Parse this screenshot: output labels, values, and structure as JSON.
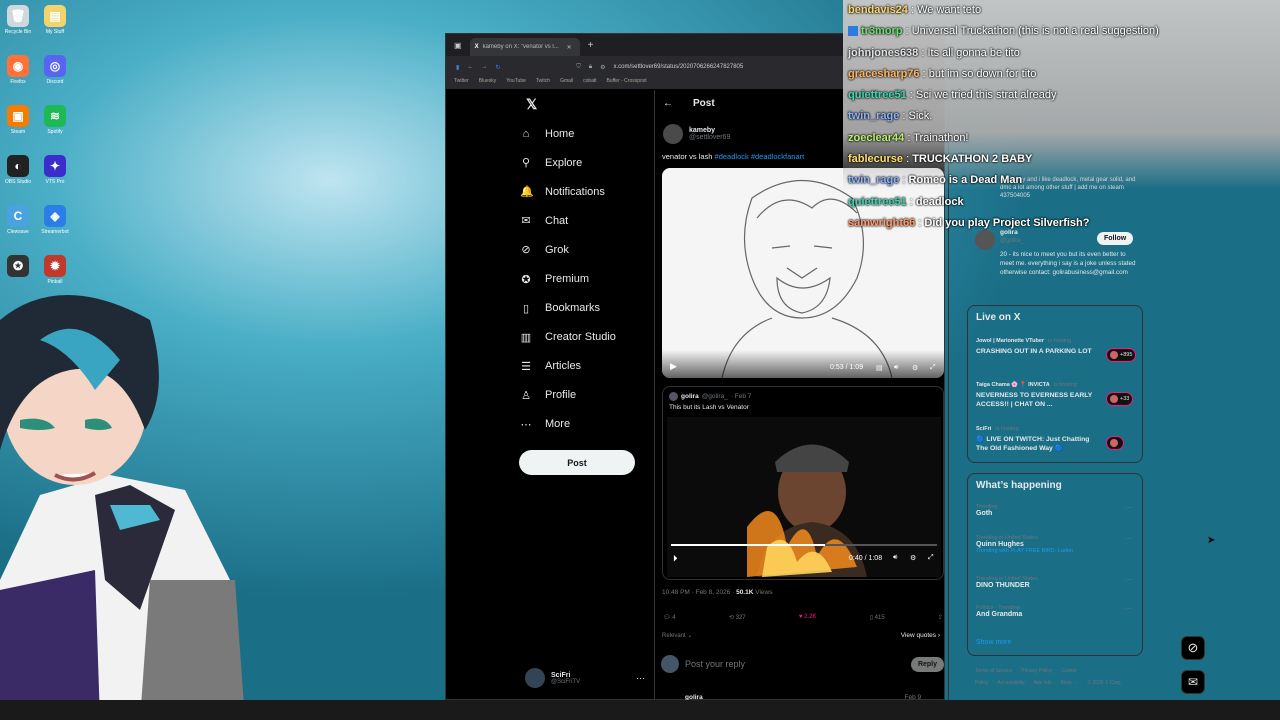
{
  "desktop_icons": [
    {
      "label": "Recycle Bin",
      "icon": "recycle-bin-icon",
      "color": "#cfd8dc",
      "glyph": "🗑"
    },
    {
      "label": "My Stuff",
      "icon": "folder-icon",
      "color": "#f3d36b",
      "glyph": "▤"
    },
    {
      "label": "Firefox",
      "icon": "firefox-icon",
      "color": "#ff7139",
      "glyph": "◉"
    },
    {
      "label": "Discord",
      "icon": "discord-icon",
      "color": "#5865f2",
      "glyph": "◎"
    },
    {
      "label": "Steam",
      "icon": "steam-icon",
      "color": "#f57c00",
      "glyph": "▣"
    },
    {
      "label": "Spotify",
      "icon": "spotify-icon",
      "color": "#1db954",
      "glyph": "≋"
    },
    {
      "label": "OBS Studio",
      "icon": "obs-icon",
      "color": "#222",
      "glyph": "◐"
    },
    {
      "label": "VTS Pro",
      "icon": "vts-icon",
      "color": "#3b2ccc",
      "glyph": "✦"
    },
    {
      "label": "Clewsave",
      "icon": "clewsave-icon",
      "color": "#4aa3df",
      "glyph": "C"
    },
    {
      "label": "Streamerbot",
      "icon": "streamerbot-icon",
      "color": "#2b7de9",
      "glyph": "◈"
    },
    {
      "label": "",
      "icon": "app-icon",
      "color": "#333",
      "glyph": "✪"
    },
    {
      "label": "Pinball",
      "icon": "pinball-icon",
      "color": "#c0392b",
      "glyph": "✹"
    }
  ],
  "browser": {
    "tab_title": "kameby on X: \"venator vs l...",
    "url": "x.com/settlover69/status/2020706266247827805",
    "bookmarks": [
      "Twitter",
      "Bluesky",
      "YouTube",
      "Twitch",
      "Gmail",
      "cobalt",
      "Buffer - Crosspost"
    ]
  },
  "nav": {
    "items": [
      {
        "label": "Home",
        "icon": "home-icon",
        "glyph": "⌂"
      },
      {
        "label": "Explore",
        "icon": "search-icon",
        "glyph": "⚲"
      },
      {
        "label": "Notifications",
        "icon": "bell-icon",
        "glyph": "🔔"
      },
      {
        "label": "Chat",
        "icon": "chat-icon",
        "glyph": "✉"
      },
      {
        "label": "Grok",
        "icon": "grok-icon",
        "glyph": "⊘"
      },
      {
        "label": "Premium",
        "icon": "premium-icon",
        "glyph": "✪"
      },
      {
        "label": "Bookmarks",
        "icon": "bookmark-icon",
        "glyph": "▯"
      },
      {
        "label": "Creator Studio",
        "icon": "creator-studio-icon",
        "glyph": "▥"
      },
      {
        "label": "Articles",
        "icon": "articles-icon",
        "glyph": "☰"
      },
      {
        "label": "Profile",
        "icon": "profile-icon",
        "glyph": "♙"
      },
      {
        "label": "More",
        "icon": "more-icon",
        "glyph": "⋯"
      }
    ],
    "post_button": "Post",
    "account": {
      "name": "SciFri",
      "handle": "@SciFriTV"
    }
  },
  "post": {
    "header": "Post",
    "author": {
      "name": "kameby",
      "handle": "@settlover69"
    },
    "text": "venator vs lash",
    "hashtags": "#deadlock #deadlockfanart",
    "video1_time": "0:53 / 1:09",
    "quote": {
      "author": "golira",
      "handle": "@golira_",
      "date": "· Feb 7",
      "text": "This but its Lash vs Venator",
      "video_time": "0:40 / 1:08"
    },
    "timestamp": "10:48 PM · Feb 8, 2026 · ",
    "views_count": "50.1K",
    "views_label": " Views",
    "stats": {
      "replies": "4",
      "reposts": "327",
      "likes": "2.2K",
      "bookmarks": "415"
    },
    "relevant": "Relevant ⌄",
    "view_quotes": "View quotes ›",
    "reply_placeholder": "Post your reply",
    "reply_button": "Reply",
    "next_author": "golira",
    "next_date": "Feb 9"
  },
  "sidebar": {
    "profile_bio_top": "me is evy and i like deadlock, metal gear solid, and dmc a lot among other stuff | add me on steam 437504005",
    "suggested": {
      "name": "golira",
      "handle": "@golira_",
      "follow": "Follow",
      "bio": "20 - its nice to meet you but its even better to meet me. everything i say is a joke unless stated otherwise contact: golirabusiness@gmail.com"
    },
    "live": {
      "title": "Live on X",
      "items": [
        {
          "host": "Jowol | Marionette VTuber",
          "status": "is hosting",
          "title": "CRASHING OUT IN A PARKING LOT",
          "count": "+895"
        },
        {
          "host": "Taiga Chama 🌸 📍 INVICTA",
          "status": "is hosting",
          "title": "NEVERNESS TO EVERNESS EARLY ACCESS!! | CHAT ON ...",
          "count": "+33"
        },
        {
          "host": "SciFri",
          "status": "is hosting",
          "title": "🔵 LIVE ON TWITCH: Just Chatting The Old Fashioned Way 🔵",
          "count": ""
        }
      ]
    },
    "happening": {
      "title": "What’s happening",
      "trends": [
        {
          "meta": "Trending",
          "name": "Goth",
          "extra": ""
        },
        {
          "meta": "Trending in United States",
          "name": "Quinn Hughes",
          "extra": "Trending with PLAY FREE BIRD, Larkin"
        },
        {
          "meta": "Trending in United States",
          "name": "DINO THUNDER",
          "extra": ""
        },
        {
          "meta": "Politics · Trending",
          "name": "And Grandma",
          "extra": ""
        }
      ],
      "show_more": "Show more"
    },
    "footer": [
      "Terms of Service",
      "Privacy Policy",
      "Cookie Policy",
      "Accessibility",
      "Ads info",
      "More ···",
      "© 2026 X Corp."
    ]
  },
  "chat": [
    {
      "user": "bendavis24",
      "color": "#ffd76a",
      "msg": "We want teto",
      "badge": false
    },
    {
      "user": "tr3morp",
      "color": "#6ee06e",
      "msg": "Universal Truckathon (this is not a real suggestion)",
      "badge": true
    },
    {
      "user": "johnjones638",
      "color": "#dfe3e6",
      "msg": "Its all gonna be tito",
      "badge": false
    },
    {
      "user": "gracesharp76",
      "color": "#ffb35c",
      "msg": "but im so down for tito",
      "badge": false
    },
    {
      "user": "quiettree51",
      "color": "#3fd6b0",
      "msg": "Sci we tried this strat already",
      "badge": false
    },
    {
      "user": "twin_rage",
      "color": "#8ab4ff",
      "msg": "Sick.",
      "badge": false
    },
    {
      "user": "zoeclear44",
      "color": "#b8f06e",
      "msg": "Trainathon!",
      "badge": false
    },
    {
      "user": "fablecurse",
      "color": "#ffe06b",
      "msg": "TRUCKATHON 2 BABY",
      "badge": false
    },
    {
      "user": "twin_rage",
      "color": "#8ab4ff",
      "msg": "Romeo is a Dead Man",
      "badge": false
    },
    {
      "user": "quiettree51",
      "color": "#3fd6b0",
      "msg": "deadlock",
      "badge": false
    },
    {
      "user": "samwright66",
      "color": "#ff9a6b",
      "msg": "Did you play Project Silverfish?",
      "badge": false
    }
  ],
  "right_icons": [
    "grok-icon",
    "messages-icon"
  ]
}
